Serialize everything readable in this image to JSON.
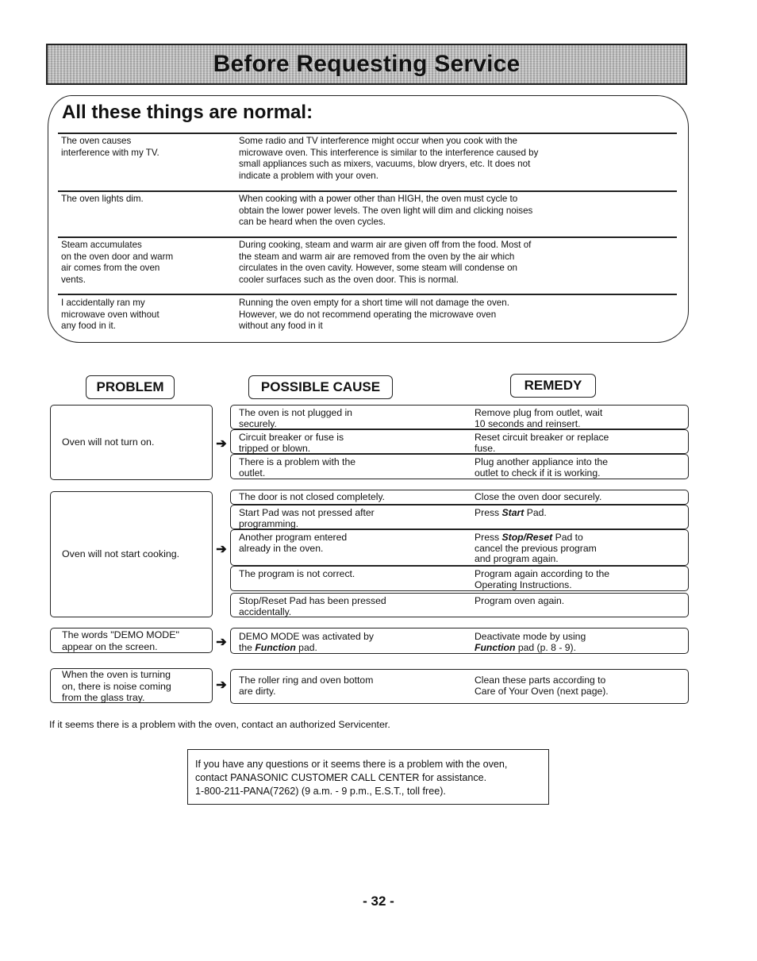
{
  "page_title": "Before Requesting Service",
  "normal_section": {
    "heading": "All these things are normal:",
    "items": [
      {
        "question_lines": [
          "The oven causes",
          "interference with my TV."
        ],
        "answer_lines": [
          "Some radio and TV interference might occur when you cook with the",
          "microwave oven. This interference is similar to the interference caused by",
          "small appliances such as mixers, vacuums, blow dryers, etc. It does not",
          "indicate a problem with your oven."
        ]
      },
      {
        "question_lines": [
          "The oven lights dim."
        ],
        "answer_lines": [
          "When cooking with a power other than HIGH, the oven must cycle to",
          "obtain the lower power levels. The oven light will dim and clicking noises",
          "can be heard when the oven cycles."
        ]
      },
      {
        "question_lines": [
          "Steam accumulates",
          "on the oven door and warm",
          "air comes from the oven",
          "vents."
        ],
        "answer_lines": [
          "During cooking, steam and warm air are given off from the food. Most of",
          "the steam and warm air are removed from the oven by the air which",
          "circulates in the oven cavity. However, some steam will condense on",
          "cooler surfaces such as the oven door. This is normal."
        ]
      },
      {
        "question_lines": [
          "I accidentally ran my",
          "microwave oven without",
          "any food in it."
        ],
        "answer_lines": [
          "Running the oven empty for a short time will not damage the oven.",
          "However, we do not recommend operating the microwave oven",
          "without any food in it"
        ]
      }
    ]
  },
  "troubleshooting": {
    "headers": {
      "problem": "PROBLEM",
      "cause": "POSSIBLE CAUSE",
      "remedy": "REMEDY"
    },
    "arrow_glyph": "➔",
    "groups": [
      {
        "problem_lines": [
          "Oven will not turn on."
        ],
        "rows": [
          {
            "cause_lines": [
              "The oven is not plugged in",
              "securely."
            ],
            "remedy_lines": [
              "Remove plug from outlet, wait",
              "10 seconds and reinsert."
            ]
          },
          {
            "cause_lines": [
              "Circuit breaker or fuse is",
              "tripped or blown."
            ],
            "remedy_lines": [
              "Reset circuit breaker or replace",
              "fuse."
            ]
          },
          {
            "cause_lines": [
              "There is a problem with the",
              "outlet."
            ],
            "remedy_lines": [
              "Plug another appliance into the",
              "outlet to check if it is working."
            ]
          }
        ]
      },
      {
        "problem_lines": [
          "Oven will not start cooking."
        ],
        "rows": [
          {
            "cause_lines": [
              "The door is not closed completely."
            ],
            "remedy_lines": [
              "Close the oven door securely."
            ]
          },
          {
            "cause_lines": [
              "Start Pad was not pressed after",
              "programming."
            ],
            "remedy_prefix": "Press ",
            "remedy_emph": "Start",
            "remedy_suffix": " Pad."
          },
          {
            "cause_lines": [
              "Another program entered",
              "already in the oven."
            ],
            "remedy_prefix": "Press ",
            "remedy_emph": "Stop/Reset",
            "remedy_suffix": " Pad to",
            "remedy_more": [
              "cancel the previous program",
              "and program again."
            ]
          },
          {
            "cause_lines": [
              "The program is not correct."
            ],
            "remedy_lines": [
              "Program again according to the",
              "Operating Instructions."
            ]
          },
          {
            "cause_lines": [
              "Stop/Reset Pad has been pressed",
              "accidentally."
            ],
            "remedy_lines": [
              "Program oven again."
            ]
          }
        ]
      },
      {
        "problem_lines": [
          "The words \"DEMO MODE\"",
          "appear on the screen."
        ],
        "rows": [
          {
            "cause_line1": "DEMO MODE was activated by",
            "cause_prefix": "the ",
            "cause_emph": "Function",
            "cause_suffix": " pad.",
            "remedy_line1": "Deactivate mode by using",
            "remedy_emph": "Function",
            "remedy_suffix": " pad (p. 8 - 9)."
          }
        ]
      },
      {
        "problem_lines": [
          "When the oven is turning",
          "on, there is noise coming",
          "from the glass tray."
        ],
        "rows": [
          {
            "cause_lines": [
              "The roller ring and oven bottom",
              "are dirty."
            ],
            "remedy_lines": [
              "Clean these parts according to",
              "Care of Your Oven (next page)."
            ]
          }
        ]
      }
    ]
  },
  "footer_note": "If it seems there is a problem with the oven, contact an authorized Servicenter.",
  "contact_box": {
    "lines": [
      "If you have any questions or it seems there is a problem with the oven,",
      "contact PANASONIC CUSTOMER CALL CENTER for assistance.",
      "1-800-211-PANA(7262) (9 a.m. - 9 p.m., E.S.T., toll free)."
    ]
  },
  "page_number": "- 32 -"
}
